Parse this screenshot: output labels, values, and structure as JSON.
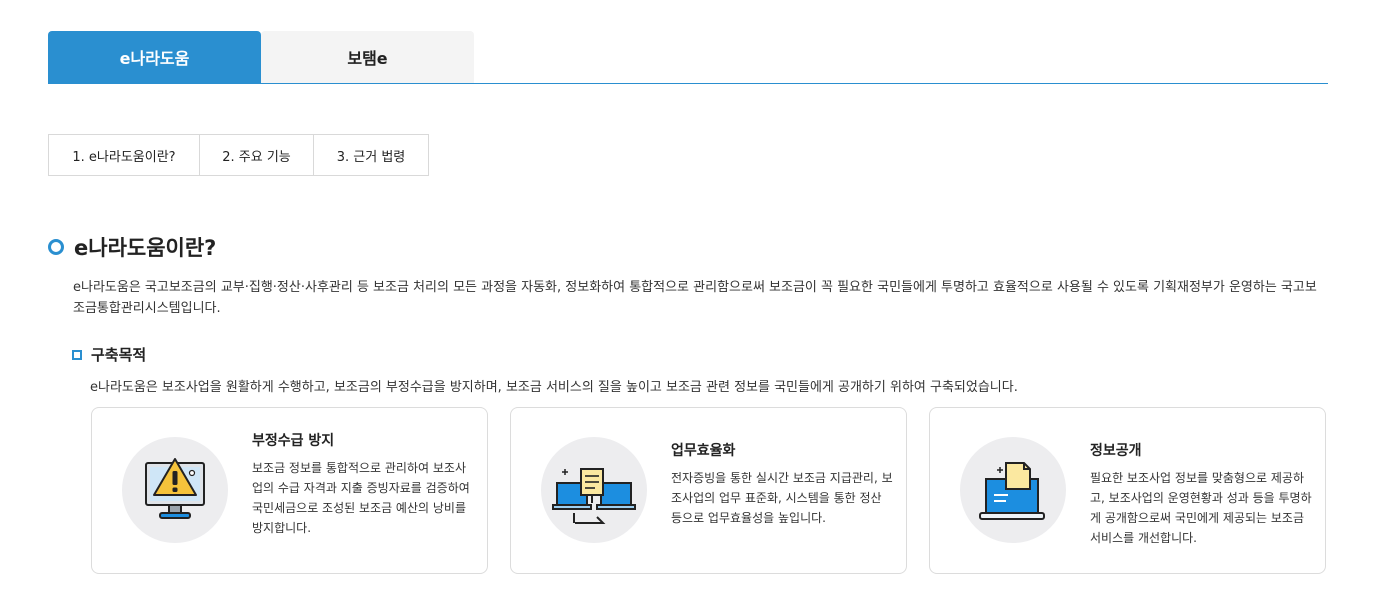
{
  "tabs": [
    {
      "label": "e나라도움",
      "active": true
    },
    {
      "label": "보탬e",
      "active": false
    }
  ],
  "subtabs": [
    "1. e나라도움이란?",
    "2. 주요 기능",
    "3. 근거 법령"
  ],
  "section": {
    "title": "e나라도움이란?",
    "intro": "e나라도움은 국고보조금의 교부·집행·정산·사후관리 등 보조금 처리의 모든 과정을 자동화, 정보화하여 통합적으로 관리함으로써 보조금이 꼭 필요한 국민들에게 투명하고 효율적으로 사용될 수 있도록 기획재정부가 운영하는 국고보조금통합관리시스템입니다."
  },
  "purpose": {
    "title": "구축목적",
    "text": "e나라도움은 보조사업을 원활하게 수행하고, 보조금의 부정수급을 방지하며, 보조금 서비스의 질을 높이고 보조금 관련 정보를 국민들에게 공개하기 위하여 구축되었습니다."
  },
  "cards": [
    {
      "title": "부정수급 방지",
      "text": "보조금 정보를 통합적으로 관리하여 보조사업의 수급 자격과 지출 증빙자료를 검증하여 국민세금으로 조성된 보조금 예산의 낭비를 방지합니다.",
      "icon": "warning-monitor-icon"
    },
    {
      "title": "업무효율화",
      "text": "전자증빙을 통한 실시간 보조금 지급관리, 보조사업의 업무 표준화, 시스템을 통한 정산 등으로 업무효율성을 높입니다.",
      "icon": "document-laptops-icon"
    },
    {
      "title": "정보공개",
      "text": "필요한 보조사업 정보를 맞춤형으로 제공하고, 보조사업의 운영현황과 성과 등을 투명하게 공개함으로써 국민에게 제공되는 보조금 서비스를 개선합니다.",
      "icon": "document-laptop-icon"
    }
  ],
  "colors": {
    "accent": "#2a8fd0",
    "icon_blue": "#1c8ee0",
    "icon_yellow": "#fbe8a0"
  }
}
